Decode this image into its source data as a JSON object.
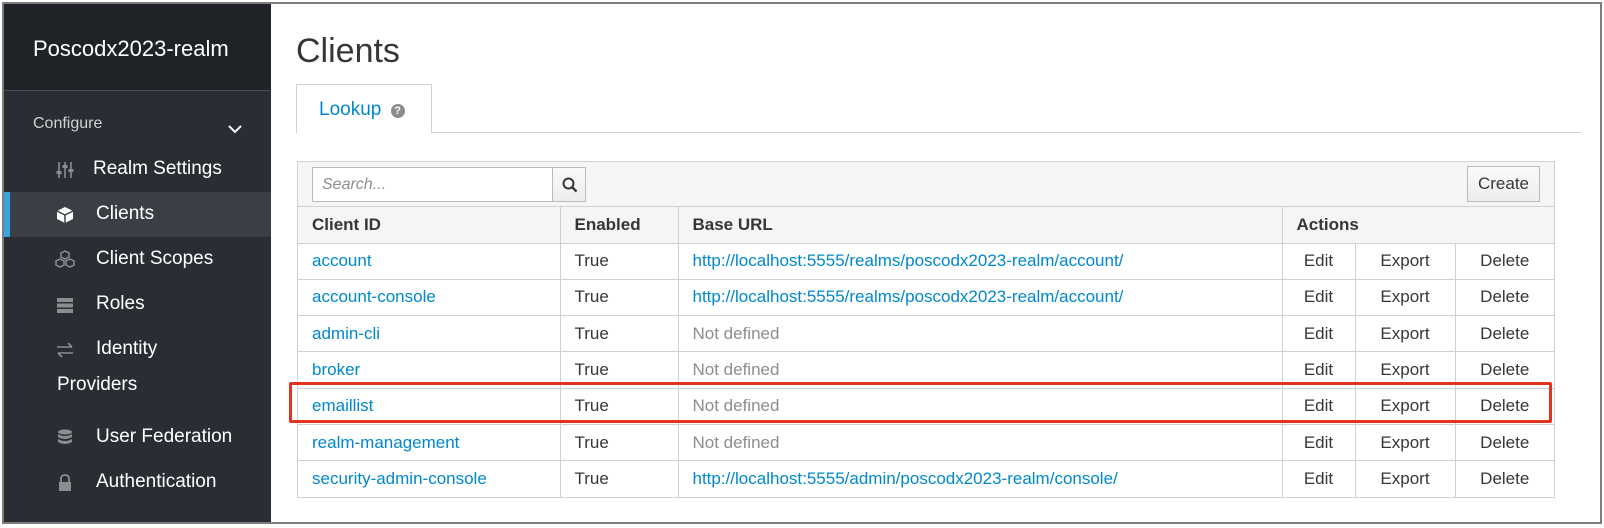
{
  "realm": {
    "name": "Poscodx2023-realm"
  },
  "sidebar": {
    "section": "Configure",
    "items": [
      {
        "label": "Realm Settings",
        "icon": "sliders-icon"
      },
      {
        "label": "Clients",
        "icon": "cube-icon",
        "active": true
      },
      {
        "label": "Client Scopes",
        "icon": "cubes-icon"
      },
      {
        "label": "Roles",
        "icon": "server-icon"
      },
      {
        "label": "Identity",
        "label2": "Providers",
        "icon": "exchange-icon"
      },
      {
        "label": "User Federation",
        "icon": "database-icon"
      },
      {
        "label": "Authentication",
        "icon": "lock-icon"
      }
    ]
  },
  "page": {
    "title": "Clients",
    "tab": "Lookup"
  },
  "toolbar": {
    "search_placeholder": "Search...",
    "create_label": "Create"
  },
  "table": {
    "headers": {
      "client_id": "Client ID",
      "enabled": "Enabled",
      "base_url": "Base URL",
      "actions": "Actions"
    },
    "action_labels": {
      "edit": "Edit",
      "export": "Export",
      "delete": "Delete"
    },
    "rows": [
      {
        "client_id": "account",
        "enabled": "True",
        "base_url": "http://localhost:5555/realms/poscodx2023-realm/account/",
        "url_defined": true
      },
      {
        "client_id": "account-console",
        "enabled": "True",
        "base_url": "http://localhost:5555/realms/poscodx2023-realm/account/",
        "url_defined": true
      },
      {
        "client_id": "admin-cli",
        "enabled": "True",
        "base_url": "Not defined",
        "url_defined": false
      },
      {
        "client_id": "broker",
        "enabled": "True",
        "base_url": "Not defined",
        "url_defined": false
      },
      {
        "client_id": "emaillist",
        "enabled": "True",
        "base_url": "Not defined",
        "url_defined": false,
        "highlighted": true
      },
      {
        "client_id": "realm-management",
        "enabled": "True",
        "base_url": "Not defined",
        "url_defined": false
      },
      {
        "client_id": "security-admin-console",
        "enabled": "True",
        "base_url": "http://localhost:5555/admin/poscodx2023-realm/console/",
        "url_defined": true
      }
    ]
  },
  "colors": {
    "link": "#0088ce",
    "sidebar_bg": "#292e34",
    "active_bar": "#39a5dc",
    "highlight": "#e0341f"
  }
}
